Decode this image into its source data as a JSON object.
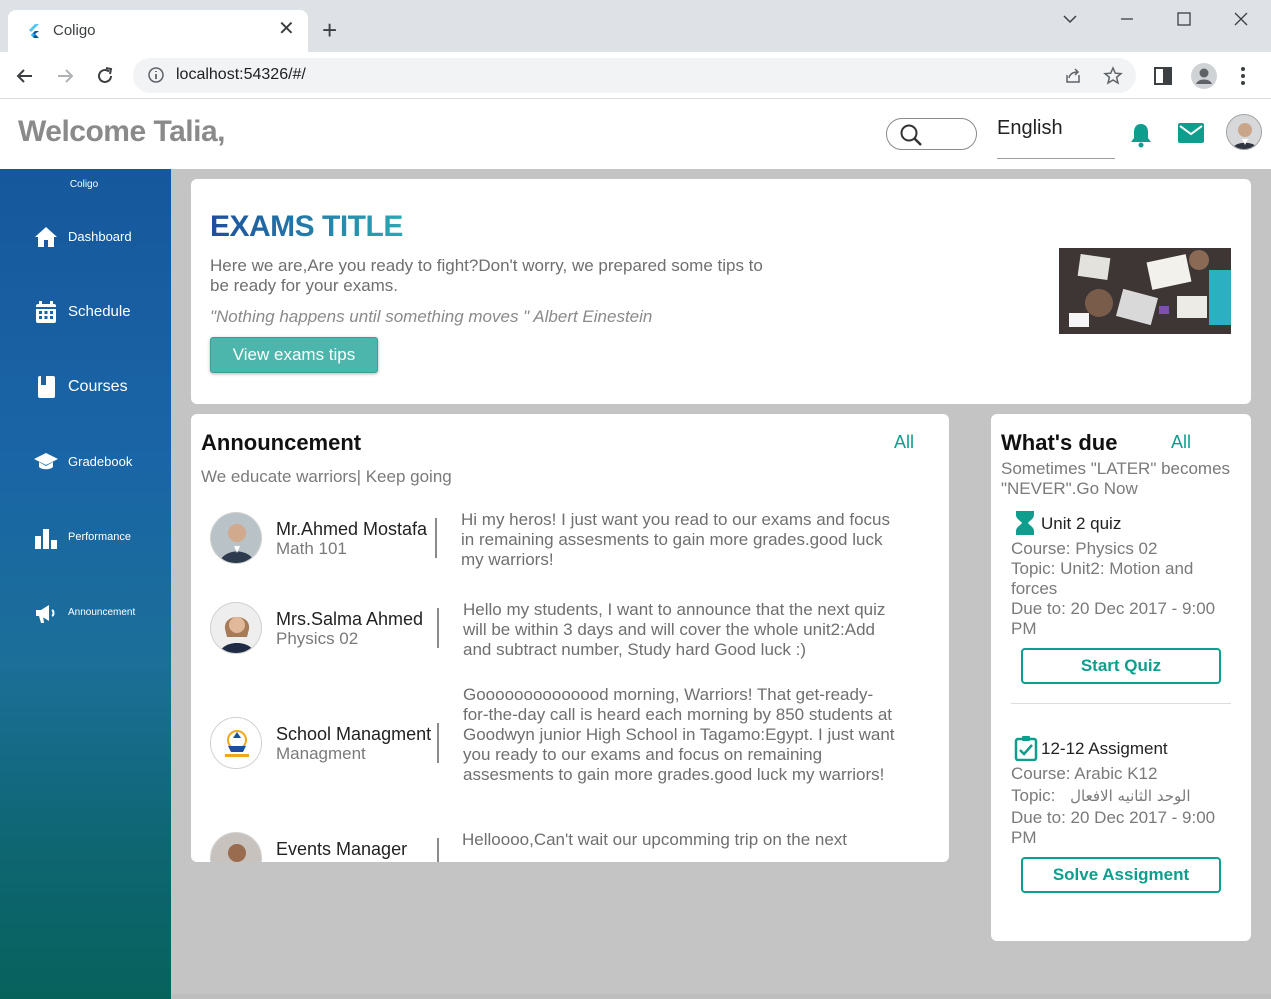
{
  "browser": {
    "tab_title": "Coligo",
    "new_tab_label": "+",
    "url": "localhost:54326/#/"
  },
  "header": {
    "welcome": "Welcome Talia,",
    "language": "English"
  },
  "sidebar": {
    "brand": "Coligo",
    "items": [
      {
        "label": "Dashboard",
        "icon": "home-icon"
      },
      {
        "label": "Schedule",
        "icon": "calendar-icon"
      },
      {
        "label": "Courses",
        "icon": "book-icon"
      },
      {
        "label": "Gradebook",
        "icon": "graduation-cap-icon"
      },
      {
        "label": "Performance",
        "icon": "bar-chart-icon"
      },
      {
        "label": "Announcement",
        "icon": "megaphone-icon"
      }
    ]
  },
  "hero": {
    "title": "EXAMS TITLE",
    "text": "Here we are,Are you ready to fight?Don't worry, we prepared some tips to be ready for your exams.",
    "quote": "\"Nothing happens until something moves \" Albert Einestein",
    "button": "View exams tips"
  },
  "announcements": {
    "title": "Announcement",
    "all_label": "All",
    "subtitle": "We educate warriors| Keep going",
    "items": [
      {
        "name": "Mr.Ahmed Mostafa",
        "course": "Math 101",
        "message": "Hi my heros! I just want you read to our exams and focus in remaining assesments to gain more grades.good luck my warriors!"
      },
      {
        "name": "Mrs.Salma Ahmed",
        "course": "Physics 02",
        "message": "Hello my students, I want to announce that the next quiz will be within 3 days and will cover the whole unit2:Add and subtract number, Study hard Good luck :)"
      },
      {
        "name": "School Managment",
        "course": "Managment",
        "message": "Goooooooooooood morning,  Warriors! That get-ready-for-the-day call is heard each morning by 850 students at Goodwyn junior High School in Tagamo:Egypt. I just want you ready to our exams and focus on remaining assesments to gain more grades.good luck my warriors!"
      },
      {
        "name": "Events Manager",
        "course": "",
        "message": "Helloooo,Can't wait our upcomming trip on the next"
      }
    ]
  },
  "due": {
    "title": "What's due",
    "all_label": "All",
    "subtitle": "Sometimes \"LATER\" becomes \"NEVER\".Go Now",
    "items": [
      {
        "icon": "hourglass-icon",
        "title": "Unit 2 quiz",
        "course": "Course: Physics 02",
        "topic": "Topic:   Unit2: Motion and forces",
        "due": "Due to:  20 Dec 2017 - 9:00 PM",
        "button": "Start Quiz"
      },
      {
        "icon": "assignment-check-icon",
        "title": "12-12 Assigment",
        "course": "Course: Arabic K12",
        "topic_label": "Topic:",
        "topic_value": "الوحد الثانيه الافعال",
        "due": "Due to:  20 Dec 2017 - 9:00 PM",
        "button": "Solve Assigment"
      }
    ]
  },
  "colors": {
    "accent": "#0e9e8e",
    "hero_button": "#4db6ac",
    "sidebar_top": "#16589c",
    "sidebar_bottom": "#07625c",
    "main_background": "#c4c4c4"
  }
}
